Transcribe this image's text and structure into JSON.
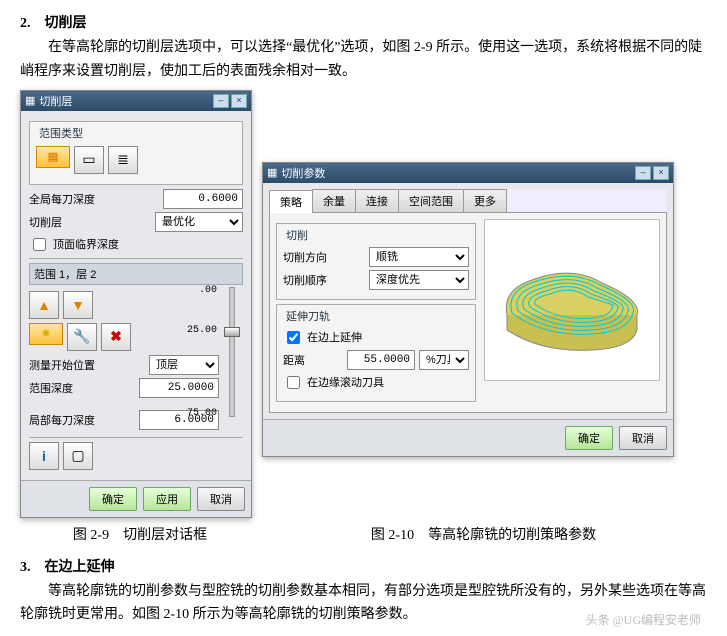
{
  "doc": {
    "h1": "2.　切削层",
    "p1": "在等高轮廓的切削层选项中，可以选择“最优化”选项，如图 2-9 所示。使用这一选项，系统将根据不同的陡峭程序来设置切削层，使加工后的表面残余相对一致。",
    "fig1cap": "图 2-9　切削层对话框",
    "fig2cap": "图 2-10　等高轮廓铣的切削策略参数",
    "h2": "3.　在边上延伸",
    "p2": "等高轮廓铣的切削参数与型腔铣的切削参数基本相同，有部分选项是型腔铣所没有的，另外某些选项在等高轮廓铣时更常用。如图 2-10 所示为等高轮廓铣的切削策略参数。",
    "watermark": "头条 @UG编程安老师"
  },
  "dlg1": {
    "title": "切削层",
    "group1": "范围类型",
    "labGlobalDepth": "全局每刀深度",
    "valGlobalDepth": "0.6000",
    "labCutLevel": "切削层",
    "valCutLevel": "最优化",
    "chkTopCrit": "顶面临界深度",
    "rangeTitle": "范围 1，层 2",
    "sliderTop": ".00",
    "sliderMid": "25.00",
    "sliderBot": "75.00",
    "labMeasureStart": "测量开始位置",
    "valMeasureStart": "顶层",
    "labRangeDepth": "范围深度",
    "valRangeDepth": "25.0000",
    "labLocalDepth": "局部每刀深度",
    "valLocalDepth": "6.0000",
    "btnOk": "确定",
    "btnApply": "应用",
    "btnCancel": "取消"
  },
  "dlg2": {
    "title": "切削参数",
    "tabs": [
      "策略",
      "余量",
      "连接",
      "空间范围",
      "更多"
    ],
    "grpCut": "切削",
    "labCutDir": "切削方向",
    "valCutDir": "顺铣",
    "labCutOrder": "切削顺序",
    "valCutOrder": "深度优先",
    "grpExt": "延伸刀轨",
    "chkExtend": "在边上延伸",
    "labDist": "距离",
    "valDist": "55.0000",
    "valDistUnit": " %刀具",
    "chkRollEdge": "在边缘滚动刀具",
    "btnOk": "确定",
    "btnCancel": "取消"
  }
}
